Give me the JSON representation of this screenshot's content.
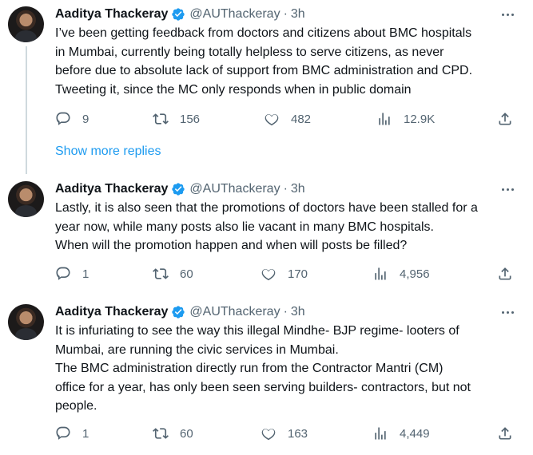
{
  "colors": {
    "accent": "#1d9bf0",
    "secondary_text": "#536471",
    "primary_text": "#0f1419"
  },
  "tweets": [
    {
      "name": "Aaditya Thackeray",
      "handle": "@AUThackeray",
      "dot": "·",
      "time": "3h",
      "lines": [
        "I’ve been getting feedback from doctors and citizens about BMC hospitals",
        "in Mumbai, currently being totally helpless to serve citizens, as never",
        "before due to absolute lack of support from BMC administration and CPD.",
        "Tweeting it, since the MC only responds when in public domain"
      ],
      "replies": "9",
      "retweets": "156",
      "likes": "482",
      "views": "12.9K"
    },
    {
      "name": "Aaditya Thackeray",
      "handle": "@AUThackeray",
      "dot": "·",
      "time": "3h",
      "lines": [
        "Lastly, it is also seen that the promotions of doctors have been stalled for a",
        "year now, while many posts also lie vacant in many BMC hospitals.",
        "When will the promotion happen and when will posts be filled?"
      ],
      "replies": "1",
      "retweets": "60",
      "likes": "170",
      "views": "4,956"
    },
    {
      "name": "Aaditya Thackeray",
      "handle": "@AUThackeray",
      "dot": "·",
      "time": "3h",
      "lines": [
        "It is infuriating to see the way this illegal Mindhe- BJP regime- looters of",
        "Mumbai, are running the civic services in Mumbai.",
        "The BMC administration directly run from the Contractor Mantri (CM)",
        "office for a year, has only been seen serving builders- contractors, but not",
        "people."
      ],
      "replies": "1",
      "retweets": "60",
      "likes": "163",
      "views": "4,449"
    }
  ],
  "show_more_replies": "Show more replies",
  "icons": {
    "verified": "verified-badge-icon",
    "more": "more-options-icon",
    "reply": "reply-icon",
    "retweet": "retweet-icon",
    "like": "like-icon",
    "views": "views-icon",
    "share": "share-icon"
  }
}
